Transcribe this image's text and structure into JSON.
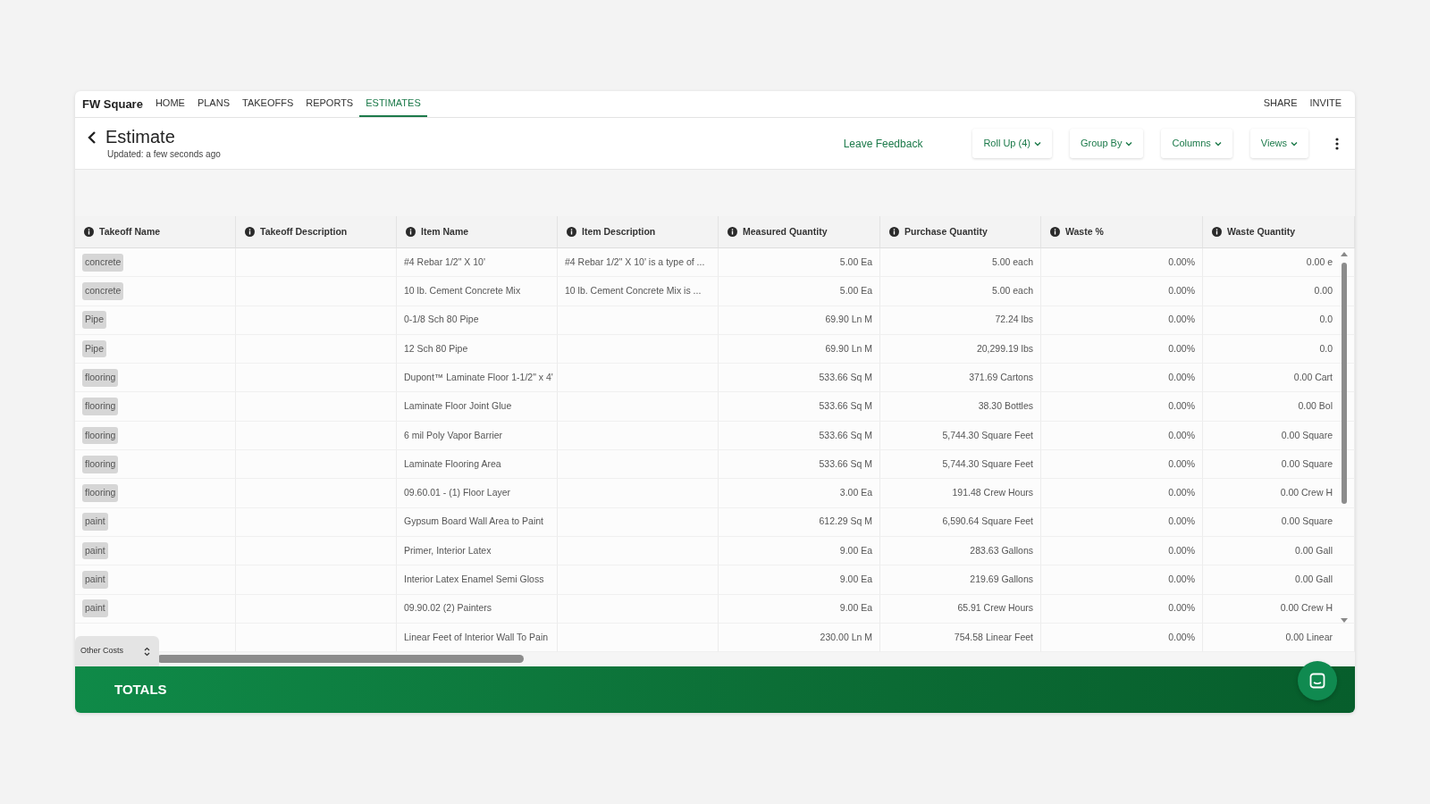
{
  "nav": {
    "brand": "FW Square",
    "links": [
      {
        "label": "HOME",
        "selected": false
      },
      {
        "label": "PLANS",
        "selected": false
      },
      {
        "label": "TAKEOFFS",
        "selected": false
      },
      {
        "label": "REPORTS",
        "selected": false
      },
      {
        "label": "ESTIMATES",
        "selected": true
      }
    ],
    "right_links": [
      "SHARE",
      "INVITE"
    ]
  },
  "header": {
    "title": "Estimate",
    "updated": "Updated: a few seconds ago",
    "feedback": "Leave Feedback",
    "dropdowns": [
      "Roll Up (4)",
      "Group By",
      "Columns",
      "Views"
    ]
  },
  "table": {
    "columns": [
      "Takeoff Name",
      "Takeoff Description",
      "Item Name",
      "Item Description",
      "Measured Quantity",
      "Purchase Quantity",
      "Waste %",
      "Waste Quantity"
    ],
    "rows": [
      [
        "concrete",
        "",
        "#4 Rebar 1/2\" X 10'",
        "#4 Rebar 1/2\" X 10' is a type of ...",
        "5.00 Ea",
        "5.00 each",
        "0.00%",
        "0.00 e"
      ],
      [
        "concrete",
        "",
        "10 lb. Cement Concrete Mix",
        "10 lb. Cement Concrete Mix is ...",
        "5.00 Ea",
        "5.00 each",
        "0.00%",
        "0.00"
      ],
      [
        "Pipe",
        "",
        "0-1/8 Sch 80 Pipe",
        "",
        "69.90 Ln M",
        "72.24 lbs",
        "0.00%",
        "0.0"
      ],
      [
        "Pipe",
        "",
        "12 Sch 80 Pipe",
        "",
        "69.90 Ln M",
        "20,299.19 lbs",
        "0.00%",
        "0.0"
      ],
      [
        "flooring",
        "",
        "Dupont™ Laminate Floor 1-1/2\" x 4'",
        "",
        "533.66 Sq M",
        "371.69 Cartons",
        "0.00%",
        "0.00 Cart"
      ],
      [
        "flooring",
        "",
        "Laminate Floor Joint Glue",
        "",
        "533.66 Sq M",
        "38.30 Bottles",
        "0.00%",
        "0.00 Bol"
      ],
      [
        "flooring",
        "",
        "6 mil Poly Vapor Barrier",
        "",
        "533.66 Sq M",
        "5,744.30 Square Feet",
        "0.00%",
        "0.00 Square"
      ],
      [
        "flooring",
        "",
        "Laminate Flooring Area",
        "",
        "533.66 Sq M",
        "5,744.30 Square Feet",
        "0.00%",
        "0.00 Square"
      ],
      [
        "flooring",
        "",
        "09.60.01 - (1) Floor Layer",
        "",
        "3.00 Ea",
        "191.48 Crew Hours",
        "0.00%",
        "0.00 Crew H"
      ],
      [
        "paint",
        "",
        "Gypsum Board Wall Area to Paint",
        "",
        "612.29 Sq M",
        "6,590.64 Square Feet",
        "0.00%",
        "0.00 Square"
      ],
      [
        "paint",
        "",
        "Primer, Interior Latex",
        "",
        "9.00 Ea",
        "283.63 Gallons",
        "0.00%",
        "0.00 Gall"
      ],
      [
        "paint",
        "",
        "Interior Latex Enamel Semi Gloss",
        "",
        "9.00 Ea",
        "219.69 Gallons",
        "0.00%",
        "0.00 Gall"
      ],
      [
        "paint",
        "",
        "09.90.02 (2) Painters",
        "",
        "9.00 Ea",
        "65.91 Crew Hours",
        "0.00%",
        "0.00 Crew H"
      ],
      [
        "",
        "",
        "Linear Feet of Interior Wall To Pain",
        "",
        "230.00 Ln M",
        "754.58 Linear Feet",
        "0.00%",
        "0.00 Linear"
      ]
    ]
  },
  "other_costs": {
    "label": "Other Costs"
  },
  "totals": {
    "label": "TOTALS"
  }
}
